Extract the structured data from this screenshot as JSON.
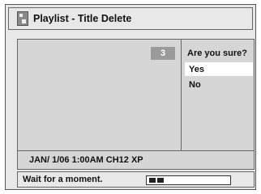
{
  "window": {
    "title": "Playlist - Title Delete",
    "icon": "playlist-icon"
  },
  "preview": {
    "badge": "3"
  },
  "confirm": {
    "question": "Are you sure?",
    "yes_label": "Yes",
    "no_label": "No",
    "selected": "Yes"
  },
  "info": {
    "text": "JAN/ 1/06 1:00AM CH12 XP"
  },
  "status": {
    "message": "Wait for a moment.",
    "progress_fraction": 0.2
  },
  "colors": {
    "background": "#e8e8e8",
    "panel": "#d6d6d6",
    "highlight": "#ffffff",
    "badge": "#9a9a9a"
  }
}
